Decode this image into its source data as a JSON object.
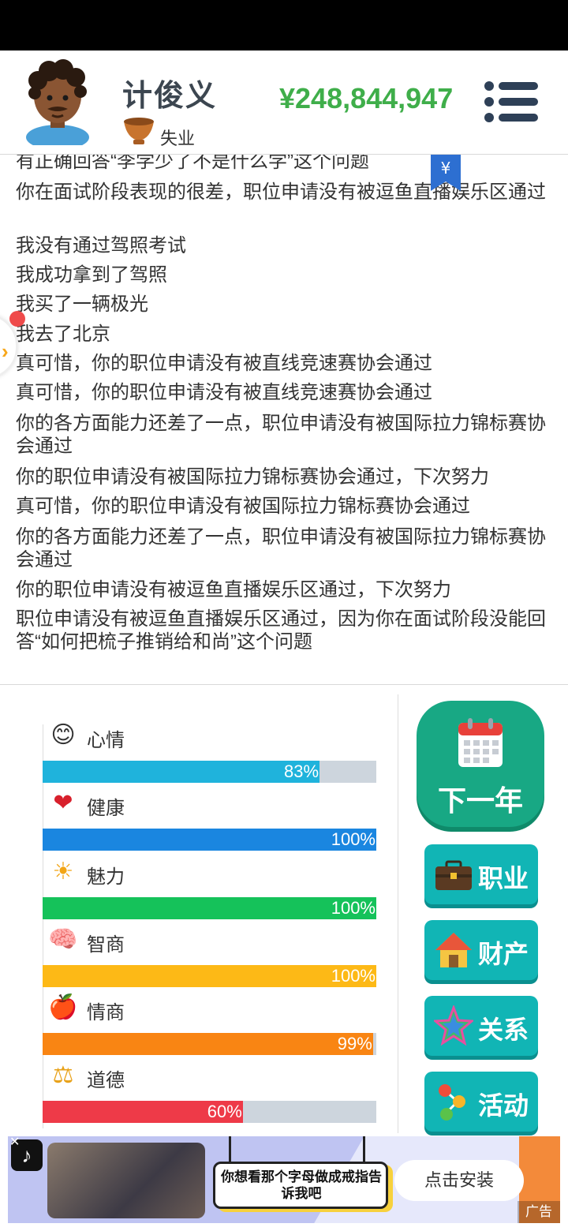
{
  "player": {
    "name": "计俊义",
    "job": "失业",
    "money": "¥248,844,947"
  },
  "log": [
    "有正确回答“李学少了不是什么学”这个问题",
    "你在面试阶段表现的很差，职位申请没有被逗鱼直播娱乐区通过",
    "我没有通过驾照考试",
    "我成功拿到了驾照",
    "我买了一辆极光",
    "我去了北京",
    "真可惜，你的职位申请没有被直线竞速赛协会通过",
    "真可惜，你的职位申请没有被直线竞速赛协会通过",
    "你的各方面能力还差了一点，职位申请没有被国际拉力锦标赛协会通过",
    "你的职位申请没有被国际拉力锦标赛协会通过，下次努力",
    "真可惜，你的职位申请没有被国际拉力锦标赛协会通过",
    "你的各方面能力还差了一点，职位申请没有被国际拉力锦标赛协会通过",
    "你的职位申请没有被逗鱼直播娱乐区通过，下次努力",
    "职位申请没有被逗鱼直播娱乐区通过，因为你在面试阶段没能回答“如何把梳子推销给和尚”这个问题"
  ],
  "yen_tag": "¥",
  "stats": [
    {
      "label": "心情",
      "percent_text": "83%",
      "value": 83,
      "color": "#1fb3dc",
      "icon": "smiley-icon",
      "glyph": "😊"
    },
    {
      "label": "健康",
      "percent_text": "100%",
      "value": 100,
      "color": "#1a86e0",
      "icon": "heart-icon",
      "glyph": "❤"
    },
    {
      "label": "魅力",
      "percent_text": "100%",
      "value": 100,
      "color": "#15c25a",
      "icon": "sun-icon",
      "glyph": "☀"
    },
    {
      "label": "智商",
      "percent_text": "100%",
      "value": 100,
      "color": "#fdb916",
      "icon": "brain-icon",
      "glyph": "🧠"
    },
    {
      "label": "情商",
      "percent_text": "99%",
      "value": 99,
      "color": "#f98513",
      "icon": "apple-icon",
      "glyph": "🍎"
    },
    {
      "label": "道德",
      "percent_text": "60%",
      "value": 60,
      "color": "#ee3a48",
      "icon": "scales-icon",
      "glyph": "⚖"
    }
  ],
  "actions": {
    "next_year": "下一年",
    "career": "职业",
    "assets": "财产",
    "relations": "关系",
    "activities": "活动"
  },
  "ad": {
    "bubble_text": "你想看那个字母做成戒指告诉我吧",
    "install": "点击安装",
    "badge": "广告",
    "tiktok_glyph": "♪",
    "close_glyph": "✕"
  }
}
